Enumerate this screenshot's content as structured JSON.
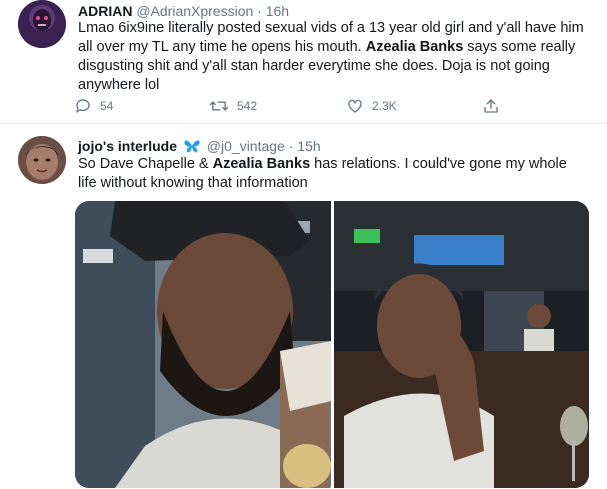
{
  "tweets": [
    {
      "name": "ADRIAN",
      "handle": "@AdrianXpression",
      "sep": "·",
      "time": "16h",
      "text_parts": [
        "Lmao 6ix9ine literally posted sexual vids of a 13 year old girl and y'all have him all over my TL any time he opens his mouth. ",
        "Azealia Banks",
        " says some really disgusting shit and y'all stan harder everytime she does. Doja is not going anywhere lol"
      ],
      "replies": "54",
      "retweets": "542",
      "likes": "2.3K"
    },
    {
      "name": "jojo's interlude",
      "handle": "@j0_vintage",
      "sep": "·",
      "time": "15h",
      "text_parts": [
        "So Dave Chapelle & ",
        "Azealia Banks",
        " has relations. I could've gone my whole life without knowing that information"
      ]
    }
  ],
  "icons": {
    "reply": "reply-icon",
    "retweet": "retweet-icon",
    "like": "heart-icon",
    "share": "share-icon",
    "butterfly": "butterfly-icon"
  },
  "colors": {
    "text": "#14171a",
    "secondary": "#657786",
    "divider": "#e6ecf0",
    "butterfly": "#1da1f2"
  }
}
